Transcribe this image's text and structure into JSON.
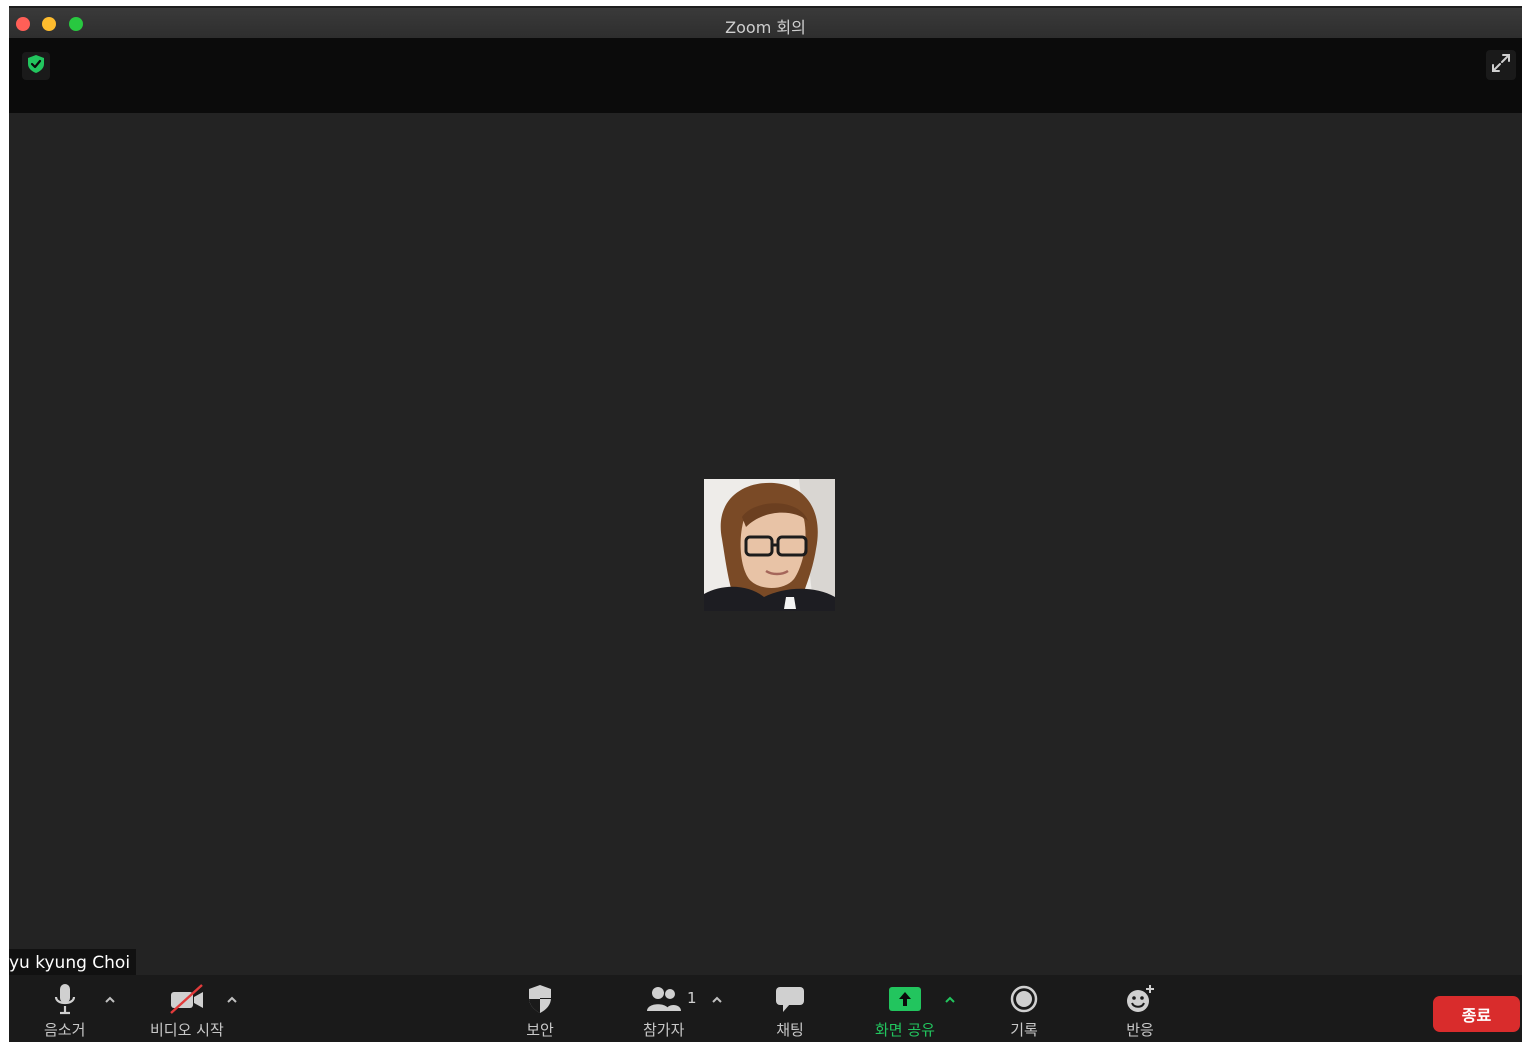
{
  "window": {
    "title": "Zoom 회의"
  },
  "stage": {
    "participant_name": "yu kyung Choi"
  },
  "toolbar": {
    "mute_label": "음소거",
    "video_label": "비디오 시작",
    "security_label": "보안",
    "participants_label": "참가자",
    "participants_count": "1",
    "chat_label": "채팅",
    "share_label": "화면 공유",
    "record_label": "기록",
    "reactions_label": "반응",
    "end_label": "종료"
  },
  "colors": {
    "background": "#232323",
    "toolbar": "#1a1a1a",
    "share_green": "#22c55e",
    "end_red": "#d92c2c",
    "security_green": "#22c55e"
  },
  "icons": {
    "security_badge": "shield-check-icon",
    "fullscreen": "expand-icon",
    "mute": "microphone-icon",
    "video": "video-off-icon",
    "security": "shield-icon",
    "participants": "people-icon",
    "chat": "chat-bubble-icon",
    "share": "share-screen-icon",
    "record": "record-icon",
    "reactions": "emoji-add-icon"
  }
}
